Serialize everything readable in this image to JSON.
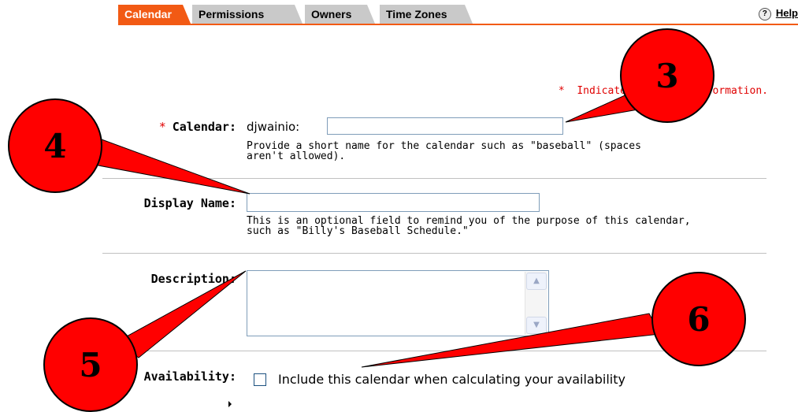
{
  "tabs": [
    {
      "label": "Calendar",
      "active": true
    },
    {
      "label": "Permissions",
      "active": false
    },
    {
      "label": "Owners",
      "active": false
    },
    {
      "label": "Time Zones",
      "active": false
    }
  ],
  "help": {
    "icon": "?",
    "label": "Help"
  },
  "required_note": {
    "star": "*",
    "text": "Indicates required information."
  },
  "form": {
    "calendar": {
      "star": "*",
      "label": "Calendar:",
      "prefix": "djwainio:",
      "value": "",
      "help_line1": "Provide a short name for the calendar such as \"baseball\" (spaces",
      "help_line2": "aren't allowed)."
    },
    "display_name": {
      "label": "Display Name:",
      "value": "",
      "help_line1": "This is an optional field to remind you of the purpose of this calendar,",
      "help_line2": "such as \"Billy's Baseball Schedule.\""
    },
    "description": {
      "label": "Description:",
      "value": ""
    },
    "availability": {
      "label": "Availability:",
      "checked": false,
      "checkbox_label": "Include this calendar when calculating your availability"
    }
  },
  "callouts": [
    {
      "number": "3"
    },
    {
      "number": "4"
    },
    {
      "number": "5"
    },
    {
      "number": "6"
    }
  ],
  "colors": {
    "accent": "#f25a14",
    "callout": "#ff0000",
    "required": "#e00000"
  }
}
